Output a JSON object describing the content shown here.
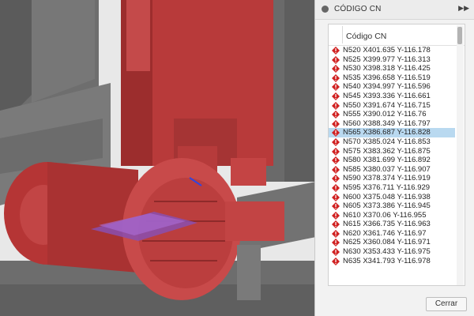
{
  "panel": {
    "title": "CÓDIGO CN",
    "expand_icon": "double-chevron-right-icon",
    "list_header": "Código CN",
    "selected_index": 10,
    "close_label": "Cerrar",
    "warning_color": "#d02020"
  },
  "nc_lines": [
    "N520 X401.635 Y-116.178",
    "N525 X399.977 Y-116.313",
    "N530 X398.318 Y-116.425",
    "N535 X396.658 Y-116.519",
    "N540 X394.997 Y-116.596",
    "N545 X393.336 Y-116.661",
    "N550 X391.674 Y-116.715",
    "N555 X390.012 Y-116.76",
    "N560 X388.349 Y-116.797",
    "N565 X386.687 Y-116.828",
    "N570 X385.024 Y-116.853",
    "N575 X383.362 Y-116.875",
    "N580 X381.699 Y-116.892",
    "N585 X380.037 Y-116.907",
    "N590 X378.374 Y-116.919",
    "N595 X376.711 Y-116.929",
    "N600 X375.048 Y-116.938",
    "N605 X373.386 Y-116.945",
    "N610 X370.06 Y-116.955",
    "N615 X366.735 Y-116.963",
    "N620 X361.746 Y-116.97",
    "N625 X360.084 Y-116.971",
    "N630 X353.433 Y-116.975",
    "N635 X341.793 Y-116.978"
  ]
}
